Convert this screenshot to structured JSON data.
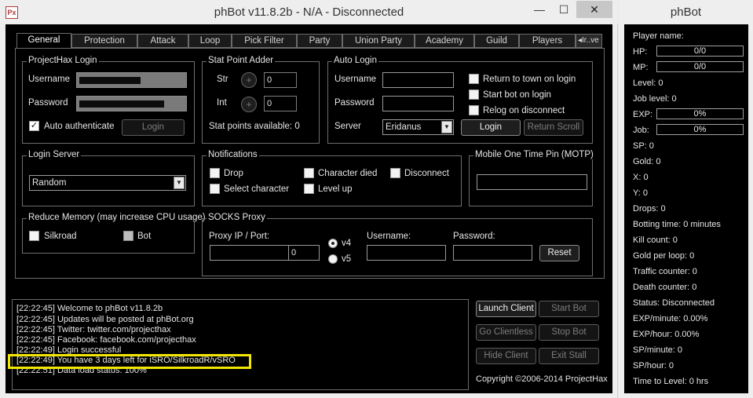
{
  "window": {
    "title": "phBot v11.8.2b - N/A - Disconnected",
    "icon": "px-app-icon",
    "minimize": "—",
    "maximize": "☐",
    "close": "✕"
  },
  "tabs": [
    {
      "label": "General",
      "active": true
    },
    {
      "label": "Protection"
    },
    {
      "label": "Attack"
    },
    {
      "label": "Loop"
    },
    {
      "label": "Pick Filter"
    },
    {
      "label": "Party"
    },
    {
      "label": "Union Party"
    },
    {
      "label": "Academy"
    },
    {
      "label": "Guild"
    },
    {
      "label": "Players"
    }
  ],
  "tab_scroll": {
    "arrow": "◂",
    "partial": "Ir..ve"
  },
  "projecthax_login": {
    "legend": "ProjectHax Login",
    "username_label": "Username",
    "password_label": "Password",
    "auto_auth_label": "Auto authenticate",
    "login_button": "Login"
  },
  "stat_point": {
    "legend": "Stat Point Adder",
    "str_label": "Str",
    "str_value": "0",
    "int_label": "Int",
    "int_value": "0",
    "plus": "+",
    "available": "Stat points available: 0"
  },
  "auto_login": {
    "legend": "Auto Login",
    "username_label": "Username",
    "password_label": "Password",
    "server_label": "Server",
    "server_value": "Eridanus",
    "return_town": "Return to town on login",
    "start_bot": "Start bot on login",
    "relog": "Relog on disconnect",
    "login_button": "Login",
    "return_scroll_button": "Return Scroll"
  },
  "login_server": {
    "legend": "Login Server",
    "value": "Random"
  },
  "notifications": {
    "legend": "Notifications",
    "drop": "Drop",
    "character_died": "Character died",
    "disconnect": "Disconnect",
    "select_character": "Select character",
    "level_up": "Level up"
  },
  "motp": {
    "legend": "Mobile One Time Pin (MOTP)"
  },
  "reduce_memory": {
    "legend": "Reduce Memory (may increase CPU usage)",
    "silkroad": "Silkroad",
    "bot": "Bot"
  },
  "socks": {
    "legend": "SOCKS Proxy",
    "proxy_label": "Proxy IP / Port:",
    "port_value": "0",
    "v4": "v4",
    "v5": "v5",
    "username_label": "Username:",
    "password_label": "Password:",
    "reset_button": "Reset"
  },
  "log": [
    "[22:22:45] Welcome to phBot v11.8.2b",
    "[22:22:45] Updates will be posted at phBot.org",
    "[22:22:45] Twitter: twitter.com/projecthax",
    "[22:22:45] Facebook: facebook.com/projecthax",
    "[22:22:49] Login successful",
    "[22:22:49] You have 3 days left for iSRO/SilkroadR/vSRO",
    "[22:22:51] Data load status: 100%"
  ],
  "controls": {
    "launch_client": "Launch Client",
    "start_bot": "Start Bot",
    "go_clientless": "Go Clientless",
    "stop_bot": "Stop Bot",
    "hide_client": "Hide Client",
    "exit_stall": "Exit Stall"
  },
  "copyright": "Copyright ©2006-2014 ProjectHax",
  "side": {
    "title": "phBot",
    "player_name": "Player name:",
    "hp_label": "HP:",
    "hp_value": "0/0",
    "mp_label": "MP:",
    "mp_value": "0/0",
    "level": "Level: 0",
    "job_level": "Job level: 0",
    "exp_label": "EXP:",
    "exp_value": "0%",
    "job_label": "Job:",
    "job_value": "0%",
    "sp": "SP: 0",
    "gold": "Gold: 0",
    "x": "X: 0",
    "y": "Y: 0",
    "drops": "Drops: 0",
    "botting_time": "Botting time: 0 minutes",
    "kill_count": "Kill count: 0",
    "gold_per_loop": "Gold per loop: 0",
    "traffic_counter": "Traffic counter: 0",
    "death_counter": "Death counter: 0",
    "status": "Status: Disconnected",
    "exp_minute": "EXP/minute: 0.00%",
    "exp_hour": "EXP/hour: 0.00%",
    "sp_minute": "SP/minute: 0",
    "sp_hour": "SP/hour: 0",
    "time_to_level": "Time to Level: 0 hrs"
  }
}
